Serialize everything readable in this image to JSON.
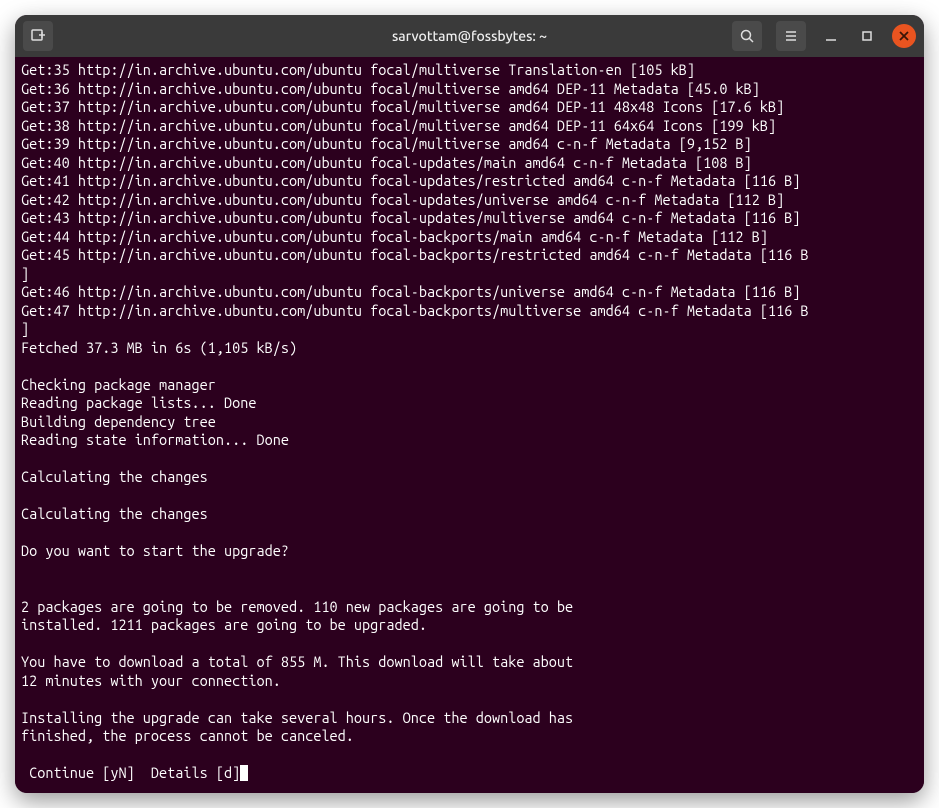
{
  "window": {
    "title": "sarvottam@fossbytes: ~"
  },
  "terminal": {
    "lines": [
      "Get:35 http://in.archive.ubuntu.com/ubuntu focal/multiverse Translation-en [105 kB]",
      "Get:36 http://in.archive.ubuntu.com/ubuntu focal/multiverse amd64 DEP-11 Metadata [45.0 kB]",
      "Get:37 http://in.archive.ubuntu.com/ubuntu focal/multiverse amd64 DEP-11 48x48 Icons [17.6 kB]",
      "Get:38 http://in.archive.ubuntu.com/ubuntu focal/multiverse amd64 DEP-11 64x64 Icons [199 kB]",
      "Get:39 http://in.archive.ubuntu.com/ubuntu focal/multiverse amd64 c-n-f Metadata [9,152 B]",
      "Get:40 http://in.archive.ubuntu.com/ubuntu focal-updates/main amd64 c-n-f Metadata [108 B]",
      "Get:41 http://in.archive.ubuntu.com/ubuntu focal-updates/restricted amd64 c-n-f Metadata [116 B]",
      "Get:42 http://in.archive.ubuntu.com/ubuntu focal-updates/universe amd64 c-n-f Metadata [112 B]",
      "Get:43 http://in.archive.ubuntu.com/ubuntu focal-updates/multiverse amd64 c-n-f Metadata [116 B]",
      "Get:44 http://in.archive.ubuntu.com/ubuntu focal-backports/main amd64 c-n-f Metadata [112 B]",
      "Get:45 http://in.archive.ubuntu.com/ubuntu focal-backports/restricted amd64 c-n-f Metadata [116 B",
      "]",
      "Get:46 http://in.archive.ubuntu.com/ubuntu focal-backports/universe amd64 c-n-f Metadata [116 B]",
      "Get:47 http://in.archive.ubuntu.com/ubuntu focal-backports/multiverse amd64 c-n-f Metadata [116 B",
      "]",
      "Fetched 37.3 MB in 6s (1,105 kB/s)",
      "",
      "Checking package manager",
      "Reading package lists... Done",
      "Building dependency tree",
      "Reading state information... Done",
      "",
      "Calculating the changes",
      "",
      "Calculating the changes",
      "",
      "Do you want to start the upgrade?",
      "",
      "",
      "2 packages are going to be removed. 110 new packages are going to be",
      "installed. 1211 packages are going to be upgraded.",
      "",
      "You have to download a total of 855 M. This download will take about",
      "12 minutes with your connection.",
      "",
      "Installing the upgrade can take several hours. Once the download has",
      "finished, the process cannot be canceled.",
      ""
    ],
    "prompt": " Continue [yN]  Details [d]"
  }
}
